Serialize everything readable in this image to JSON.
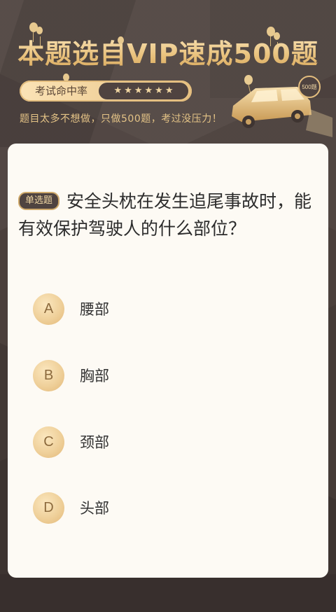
{
  "header": {
    "title": "本题选自VIP速成500题",
    "rate_label": "考试命中率",
    "stars": [
      "★",
      "★",
      "★",
      "★",
      "★",
      "★"
    ],
    "subtitle": "题目太多不想做，只做500题，考过没压力！",
    "car_badge": "500题"
  },
  "question": {
    "type_badge": "单选题",
    "text": "安全头枕在发生追尾事故时，能有效保护驾驶人的什么部位？"
  },
  "options": [
    {
      "letter": "A",
      "text": "腰部"
    },
    {
      "letter": "B",
      "text": "胸部"
    },
    {
      "letter": "C",
      "text": "颈部"
    },
    {
      "letter": "D",
      "text": "头部"
    }
  ],
  "colors": {
    "background": "#4b403c",
    "accent_gold": "#e8c283",
    "card": "#fdfaf4",
    "dark_badge": "#4f4340"
  }
}
